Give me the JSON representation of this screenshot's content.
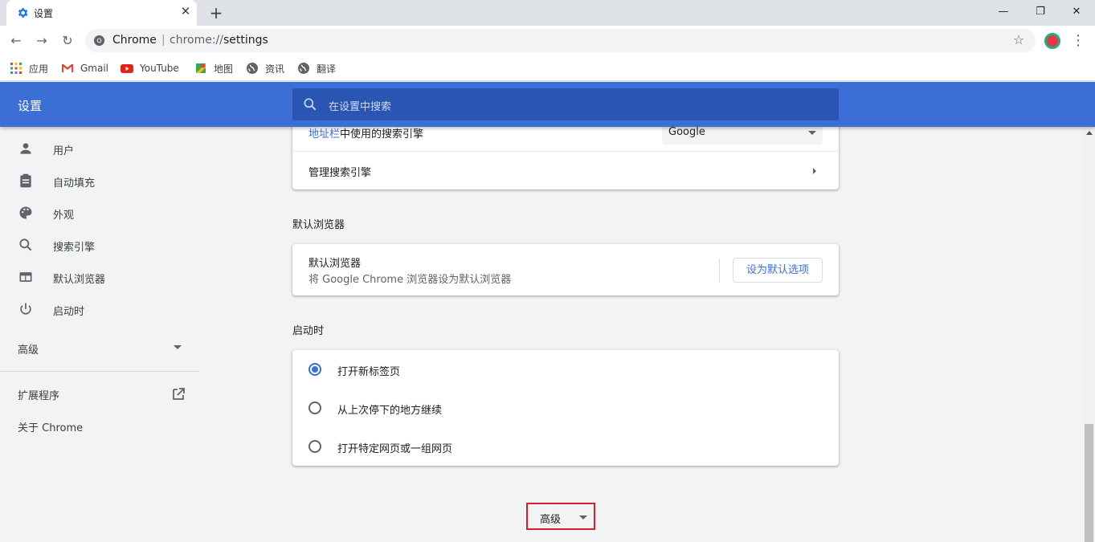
{
  "browser": {
    "tab_title": "设置",
    "tab_close": "✕",
    "new_tab": "+",
    "win_minimize": "—",
    "win_restore": "❐",
    "win_close": "✕",
    "back": "←",
    "forward": "→",
    "reload": "↻",
    "chip": "Chrome",
    "separator": "|",
    "url_scheme": "chrome://",
    "url_path": "settings",
    "star": "☆",
    "menu": "⋮",
    "bookmarks": [
      {
        "label": "应用",
        "icon": "apps-grid-icon"
      },
      {
        "label": "Gmail",
        "icon": "gmail-icon"
      },
      {
        "label": "YouTube",
        "icon": "youtube-icon"
      },
      {
        "label": "地图",
        "icon": "maps-icon"
      },
      {
        "label": "资讯",
        "icon": "globe-icon"
      },
      {
        "label": "翻译",
        "icon": "globe-icon"
      }
    ]
  },
  "header": {
    "title": "设置",
    "search_placeholder": "在设置中搜索"
  },
  "sidebar": {
    "items": [
      {
        "label": "用户",
        "icon": "person-icon"
      },
      {
        "label": "自动填充",
        "icon": "clipboard-icon"
      },
      {
        "label": "外观",
        "icon": "palette-icon"
      },
      {
        "label": "搜索引擎",
        "icon": "search-icon"
      },
      {
        "label": "默认浏览器",
        "icon": "browser-window-icon"
      },
      {
        "label": "启动时",
        "icon": "power-icon"
      }
    ],
    "advanced": "高级",
    "extensions": "扩展程序",
    "about": "关于 Chrome"
  },
  "search_engine": {
    "row_link": "地址栏",
    "row_rest": "中使用的搜索引擎",
    "selected": "Google",
    "manage": "管理搜索引擎"
  },
  "default_browser": {
    "section": "默认浏览器",
    "title": "默认浏览器",
    "subtitle": "将 Google Chrome 浏览器设为默认浏览器",
    "button": "设为默认选项"
  },
  "startup": {
    "section": "启动时",
    "options": [
      {
        "label": "打开新标签页",
        "checked": true
      },
      {
        "label": "从上次停下的地方继续",
        "checked": false
      },
      {
        "label": "打开特定网页或一组网页",
        "checked": false
      }
    ]
  },
  "footer": {
    "advanced": "高级"
  },
  "colors": {
    "accent": "#3b6fd6",
    "header_bg": "#3b6fd6",
    "search_bg": "#2a55b3",
    "highlight_border": "#d3202a"
  }
}
